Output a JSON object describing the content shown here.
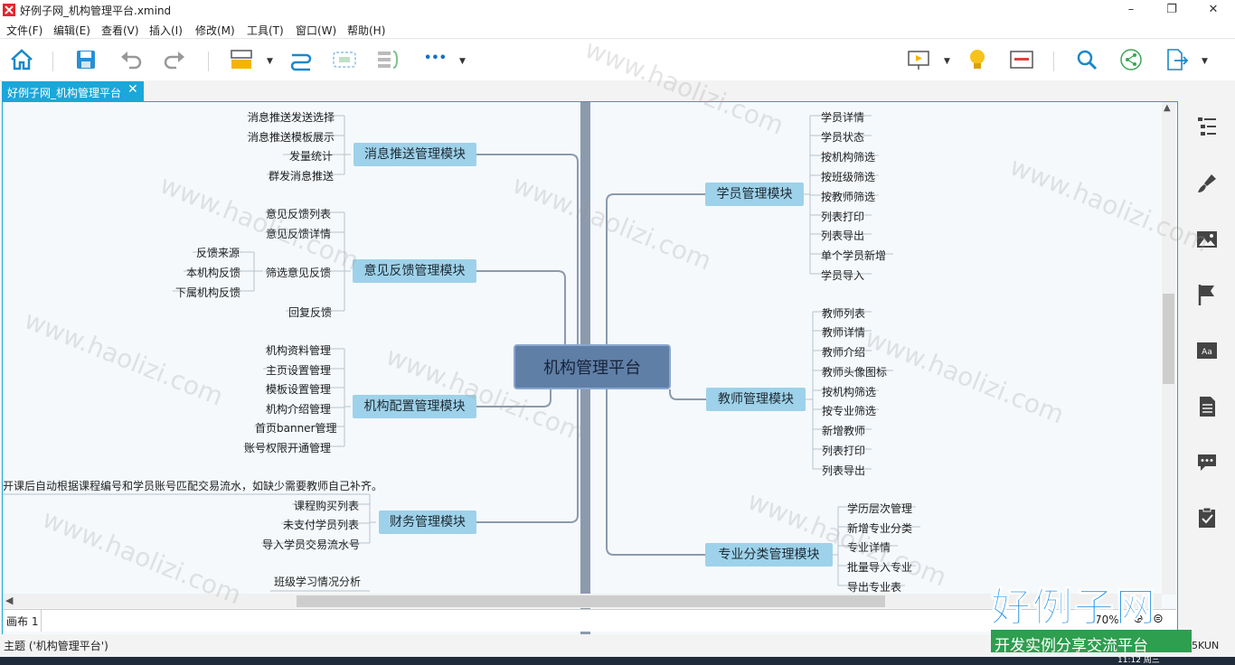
{
  "window": {
    "title": "好例子网_机构管理平台.xmind",
    "minimize": "–",
    "maximize": "❐",
    "close": "✕"
  },
  "menu": [
    "文件(F)",
    "编辑(E)",
    "查看(V)",
    "插入(I)",
    "修改(M)",
    "工具(T)",
    "窗口(W)",
    "帮助(H)"
  ],
  "toolbar": {
    "icons": [
      "home-icon",
      "save-icon",
      "undo-icon",
      "redo-icon",
      "topic-style-icon",
      "relationship-icon",
      "boundary-icon",
      "summary-icon",
      "more-icon",
      "presentation-icon",
      "idea-icon",
      "gantt-icon",
      "search-icon",
      "share-icon",
      "export-icon"
    ],
    "more_label": "•••"
  },
  "tab": {
    "label": "好例子网_机构管理平台",
    "close": "✕"
  },
  "map": {
    "central": "机构管理平台",
    "left": [
      {
        "label": "消息推送管理模块",
        "children": [
          "消息推送发送选择",
          "消息推送模板展示",
          "发量统计",
          "群发消息推送"
        ]
      },
      {
        "label": "意见反馈管理模块",
        "children": [
          "意见反馈列表",
          "意见反馈详情",
          "筛选意见反馈",
          "回复反馈"
        ],
        "grandchildren": [
          "反馈来源",
          "本机构反馈",
          "下属机构反馈"
        ]
      },
      {
        "label": "机构配置管理模块",
        "children": [
          "机构资料管理",
          "主页设置管理",
          "模板设置管理",
          "机构介绍管理",
          "首页banner管理",
          "账号权限开通管理"
        ]
      },
      {
        "label": "财务管理模块",
        "children": [
          "课程购买列表",
          "未支付学员列表",
          "导入学员交易流水号"
        ],
        "note": "开课后自动根据课程编号和学员账号匹配交易流水，如缺少需要教师自己补齐。"
      },
      {
        "label": "",
        "children": [
          "班级学习情况分析"
        ]
      }
    ],
    "right": [
      {
        "label": "学员管理模块",
        "children": [
          "学员详情",
          "学员状态",
          "按机构筛选",
          "按班级筛选",
          "按教师筛选",
          "列表打印",
          "列表导出",
          "单个学员新增",
          "学员导入"
        ]
      },
      {
        "label": "教师管理模块",
        "children": [
          "教师列表",
          "教师详情",
          "教师介绍",
          "教师头像图标",
          "按机构筛选",
          "按专业筛选",
          "新增教师",
          "列表打印",
          "列表导出"
        ]
      },
      {
        "label": "专业分类管理模块",
        "children": [
          "学历层次管理",
          "新增专业分类",
          "专业详情",
          "批量导入专业",
          "导出专业表"
        ]
      }
    ]
  },
  "sheet": {
    "label": "画布 1",
    "zoom": "70%"
  },
  "status": {
    "text": "主题 ('机构管理平台')",
    "right": "5KUN",
    "clock": "11:12 周三"
  },
  "watermark": {
    "text": "www.haolizi.com",
    "brand": "好例子网",
    "slogan": "开发实例分享交流平台"
  },
  "colors": {
    "accent": "#1aa7d9",
    "topic": "#9ed2ea",
    "central": "#5f7fa6",
    "trunk": "#8c9aad",
    "brand": "#1e90e8"
  }
}
